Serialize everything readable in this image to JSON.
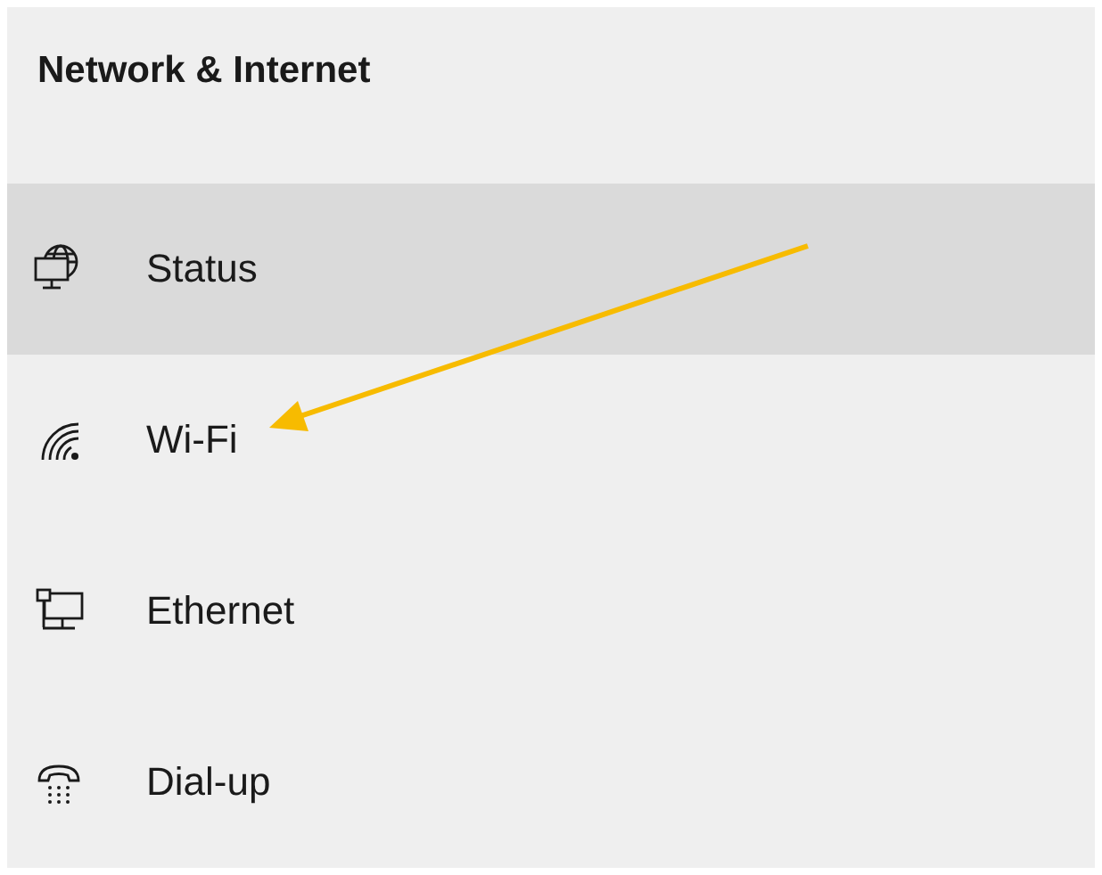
{
  "title": "Network & Internet",
  "nav_items": [
    {
      "label": "Status",
      "kind": "status",
      "selected": true
    },
    {
      "label": "Wi-Fi",
      "kind": "wifi",
      "selected": false
    },
    {
      "label": "Ethernet",
      "kind": "ethernet",
      "selected": false
    },
    {
      "label": "Dial-up",
      "kind": "dialup",
      "selected": false
    }
  ],
  "annotations": [
    {
      "kind": "arrow"
    }
  ]
}
